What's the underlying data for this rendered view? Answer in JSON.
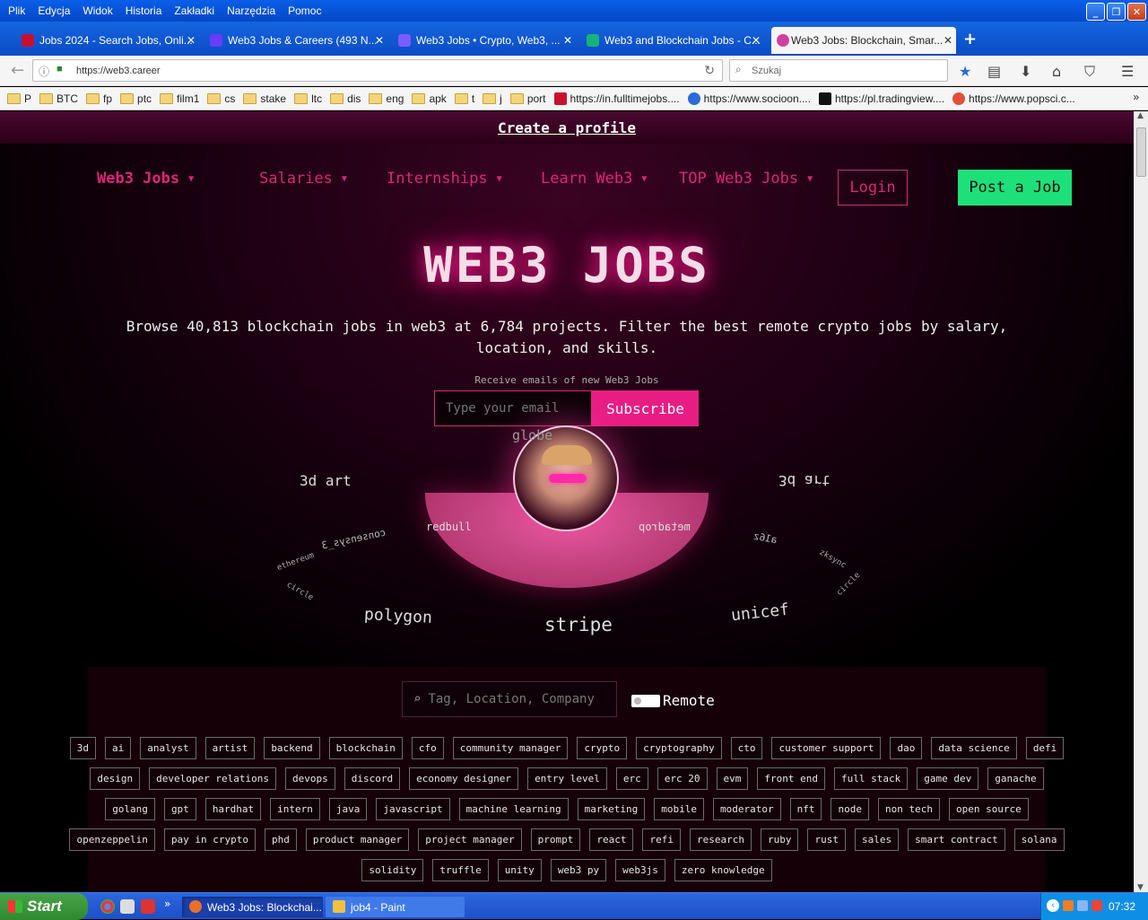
{
  "window": {
    "menu": [
      "Plik",
      "Edycja",
      "Widok",
      "Historia",
      "Zakładki",
      "Narzędzia",
      "Pomoc"
    ]
  },
  "tabs": [
    {
      "title": "Jobs 2024 - Search Jobs, Onli...",
      "color": "#c8102e"
    },
    {
      "title": "Web3 Jobs & Careers (493 N...",
      "color": "#6b3cf5"
    },
    {
      "title": "Web3 Jobs • Crypto, Web3, ...",
      "color": "#7a5cff"
    },
    {
      "title": "Web3 and Blockchain Jobs - C...",
      "color": "#16b27a"
    },
    {
      "title": "Web3 Jobs: Blockchain, Smar...",
      "color": "#d1409e"
    }
  ],
  "addressbar": {
    "url": "https://web3.career",
    "search_placeholder": "Szukaj"
  },
  "bookmarks": [
    "P",
    "BTC",
    "fp",
    "ptc",
    "film1",
    "cs",
    "stake",
    "ltc",
    "dis",
    "eng",
    "apk",
    "t",
    "j",
    "port",
    "https://in.fulltimejobs....",
    "https://www.socioon....",
    "https://pl.tradingview....",
    "https://www.popsci.c..."
  ],
  "site": {
    "create_profile": "Create a profile",
    "nav": {
      "web3jobs": "Web3 Jobs",
      "salaries": "Salaries",
      "internships": "Internships",
      "learn": "Learn Web3",
      "top": "TOP Web3 Jobs",
      "login": "Login",
      "post": "Post a Job"
    },
    "hero_title": "WEB3 JOBS",
    "subtitle": "Browse 40,813 blockchain jobs in web3 at 6,784 projects. Filter the best remote crypto jobs by salary, location, and skills.",
    "receive": "Receive emails of new Web3 Jobs",
    "email_placeholder": "Type your email",
    "subscribe": "Subscribe",
    "word_cloud": {
      "globe": "globe",
      "art_left": "3d art",
      "art_right": "3d art",
      "redbull": "redbull",
      "metadrop": "metadrop",
      "consensys": "consensys_3",
      "a16z": "a16z",
      "polygon": "polygon",
      "stripe": "stripe",
      "unicef": "unicef",
      "edge_left1": "ethereum",
      "edge_left2": "circle",
      "edge_right1": "zksync",
      "edge_right2": "circle"
    },
    "search_placeholder": "Tag, Location, Company",
    "remote_label": "Remote",
    "tags": [
      [
        "3d",
        "ai",
        "analyst",
        "artist",
        "backend",
        "blockchain",
        "cfo",
        "community manager",
        "crypto",
        "cryptography",
        "cto",
        "customer support",
        "dao",
        "data science",
        "defi"
      ],
      [
        "design",
        "developer relations",
        "devops",
        "discord",
        "economy designer",
        "entry level",
        "erc",
        "erc 20",
        "evm",
        "front end",
        "full stack",
        "game dev",
        "ganache"
      ],
      [
        "golang",
        "gpt",
        "hardhat",
        "intern",
        "java",
        "javascript",
        "machine learning",
        "marketing",
        "mobile",
        "moderator",
        "nft",
        "node",
        "non tech",
        "open source"
      ],
      [
        "openzeppelin",
        "pay in crypto",
        "phd",
        "product manager",
        "project manager",
        "prompt",
        "react",
        "refi",
        "research",
        "ruby",
        "rust",
        "sales",
        "smart contract",
        "solana"
      ],
      [
        "solidity",
        "truffle",
        "unity",
        "web3 py",
        "web3js",
        "zero knowledge"
      ]
    ]
  },
  "taskbar": {
    "start": "Start",
    "tasks": [
      "Web3 Jobs: Blockchai...",
      "job4 - Paint"
    ],
    "clock": "07:32"
  },
  "colors": {
    "accent": "#e0247a",
    "post": "#1ee07a",
    "subscribe": "#e81d84"
  }
}
